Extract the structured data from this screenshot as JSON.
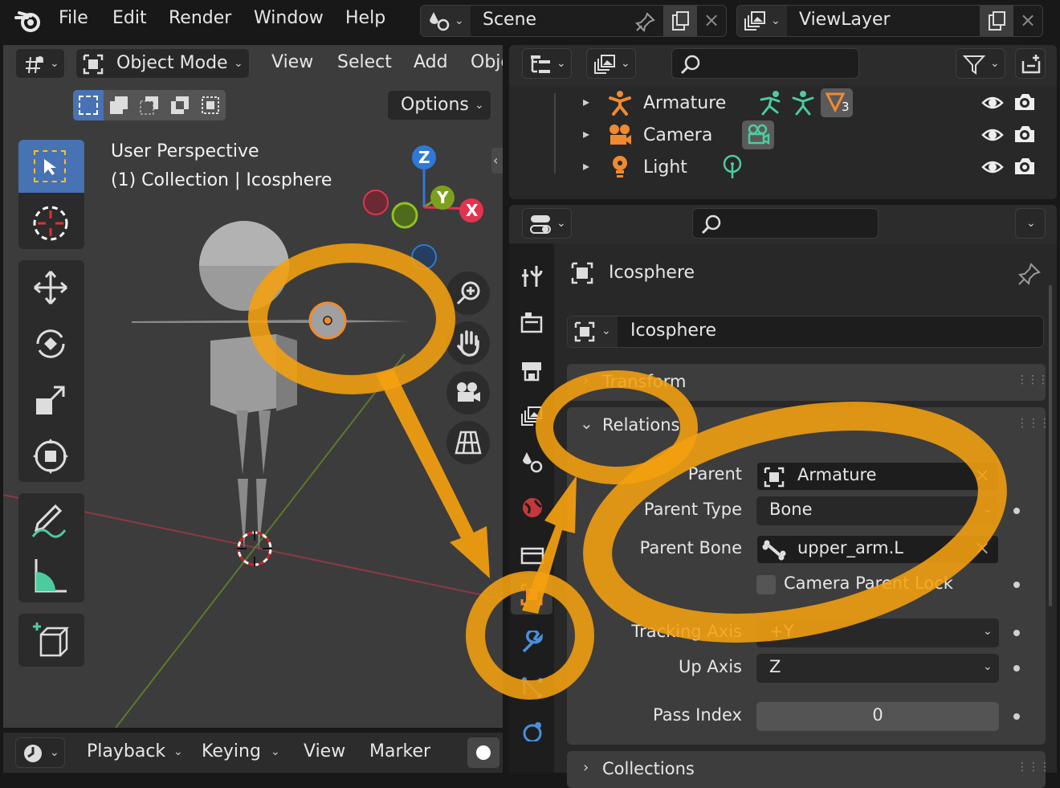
{
  "menu": {
    "file": "File",
    "edit": "Edit",
    "render": "Render",
    "window": "Window",
    "help": "Help"
  },
  "scene": {
    "name": "Scene"
  },
  "view_layer": {
    "name": "ViewLayer"
  },
  "viewport": {
    "mode": "Object Mode",
    "menu_view": "View",
    "menu_select": "Select",
    "menu_add": "Add",
    "menu_object": "Obje",
    "options": "Options",
    "overlay_line1": "User Perspective",
    "overlay_line2": "(1) Collection | Icosphere",
    "gizmo": {
      "z": "Z",
      "y": "Y",
      "x": "X"
    }
  },
  "outliner": {
    "rows": [
      {
        "name": "Armature",
        "badge": "3"
      },
      {
        "name": "Camera"
      },
      {
        "name": "Light"
      }
    ]
  },
  "properties": {
    "object_name_header": "Icosphere",
    "object_name_field": "Icosphere",
    "panel_transform": "Transform",
    "panel_relations": "Relations",
    "panel_collections": "Collections",
    "rows": {
      "parent_label": "Parent",
      "parent_value": "Armature",
      "parent_type_label": "Parent Type",
      "parent_type_value": "Bone",
      "parent_bone_label": "Parent Bone",
      "parent_bone_value": "upper_arm.L",
      "camera_parent_lock": "Camera Parent Lock",
      "tracking_axis_label": "Tracking Axis",
      "tracking_axis_value": "+Y",
      "up_axis_label": "Up Axis",
      "up_axis_value": "Z",
      "pass_index_label": "Pass Index",
      "pass_index_value": "0"
    }
  },
  "timeline": {
    "playback": "Playback",
    "keying": "Keying",
    "view": "View",
    "marker": "Marker"
  },
  "colors": {
    "annotation": "#f5a00f",
    "selected": "#4772b3",
    "active_object": "#f08a30",
    "axis_x": "#e4324f",
    "axis_y": "#7ca01c",
    "axis_z": "#2f79d6"
  }
}
